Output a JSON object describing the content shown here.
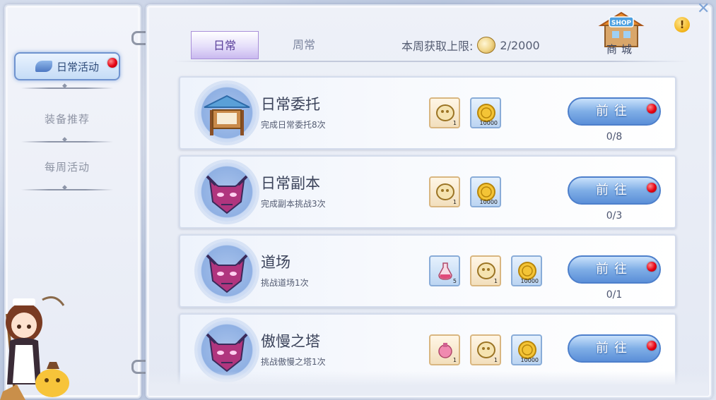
{
  "sidebar": {
    "items": [
      {
        "label": "日常活动",
        "active": true,
        "has_alert": true
      },
      {
        "label": "装备推荐",
        "active": false
      },
      {
        "label": "每周活动",
        "active": false
      }
    ]
  },
  "header": {
    "tabs": [
      {
        "label": "日常",
        "active": true
      },
      {
        "label": "周常",
        "active": false
      }
    ],
    "limit_label": "本周获取上限:",
    "limit_value": "2/2000",
    "shop_label": "商城",
    "info_icon": "!"
  },
  "tasks": [
    {
      "title": "日常委托",
      "desc": "完成日常委托8次",
      "icon": "notice-board-icon",
      "rewards": [
        {
          "type": "bronze-medal",
          "count": "1"
        },
        {
          "type": "gold-coin",
          "count": "10000"
        }
      ],
      "button": "前往",
      "has_alert": true,
      "progress": "0/8"
    },
    {
      "title": "日常副本",
      "desc": "完成副本挑战3次",
      "icon": "demon-mask-icon",
      "rewards": [
        {
          "type": "bronze-medal",
          "count": "1"
        },
        {
          "type": "gold-coin",
          "count": "10000"
        }
      ],
      "button": "前往",
      "has_alert": true,
      "progress": "0/3"
    },
    {
      "title": "道场",
      "desc": "挑战道场1次",
      "icon": "demon-mask-icon",
      "rewards": [
        {
          "type": "potion",
          "count": "5"
        },
        {
          "type": "bronze-medal",
          "count": "1"
        },
        {
          "type": "gold-coin",
          "count": "10000"
        }
      ],
      "button": "前往",
      "has_alert": true,
      "progress": "0/1"
    },
    {
      "title": "傲慢之塔",
      "desc": "挑战傲慢之塔1次",
      "icon": "demon-mask-icon",
      "rewards": [
        {
          "type": "pink-potion",
          "count": "1"
        },
        {
          "type": "bronze-medal",
          "count": "1"
        },
        {
          "type": "gold-coin",
          "count": "10000"
        }
      ],
      "button": "前往",
      "has_alert": true,
      "progress": ""
    }
  ],
  "colors": {
    "accent_blue": "#5b8fd8",
    "alert_red": "#e60012",
    "tab_purple": "#a98fd9"
  }
}
